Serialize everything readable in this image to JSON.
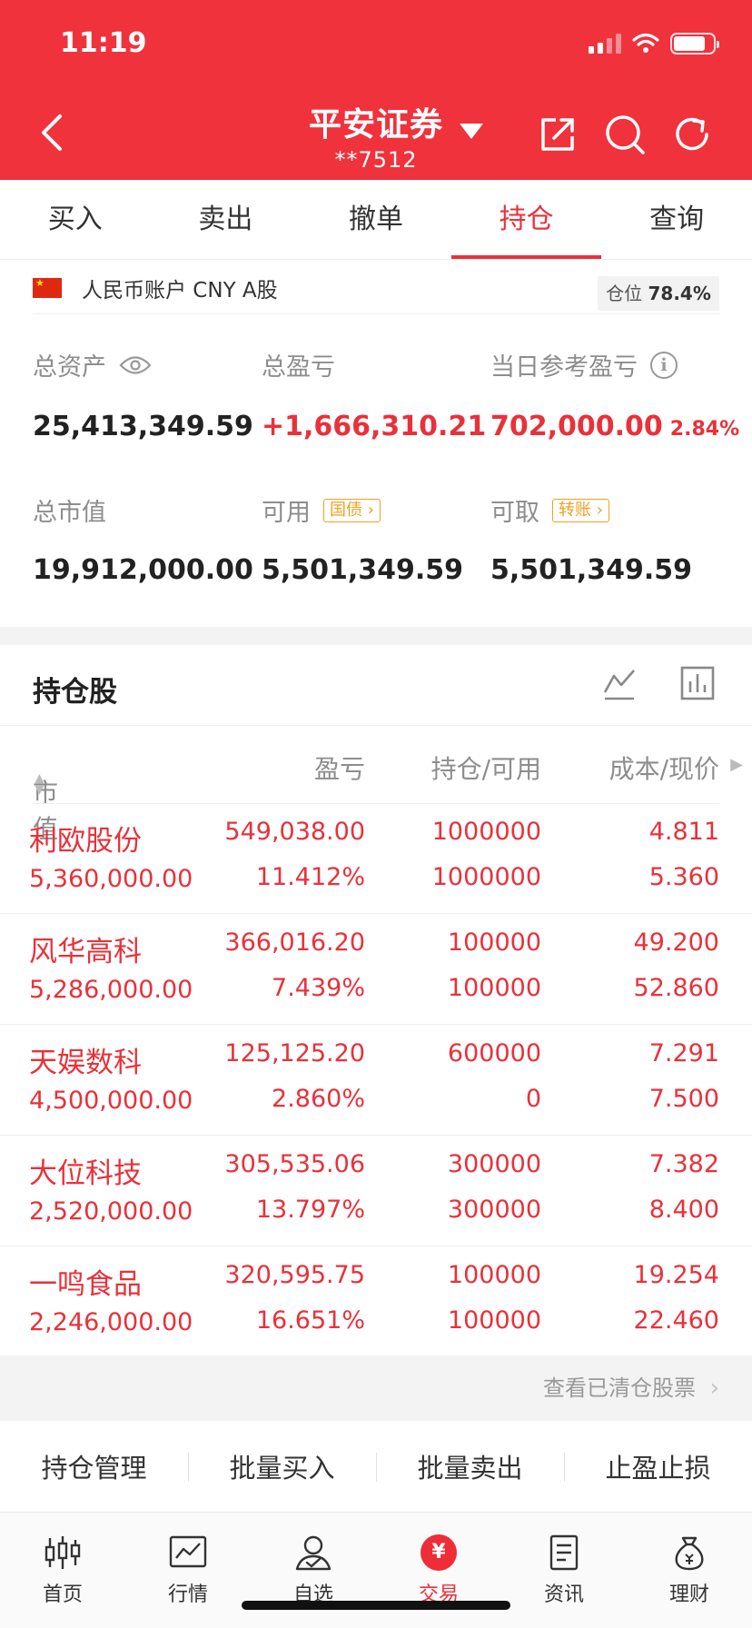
{
  "status": {
    "time": "11:19"
  },
  "header": {
    "title": "平安证券",
    "account_masked": "**7512"
  },
  "tabs": [
    {
      "label": "买入"
    },
    {
      "label": "卖出"
    },
    {
      "label": "撤单"
    },
    {
      "label": "持仓",
      "active": true
    },
    {
      "label": "查询"
    }
  ],
  "account": {
    "label": "人民币账户 CNY A股",
    "position_label": "仓位",
    "position_value": "78.4%",
    "total_assets_label": "总资产",
    "total_assets": "25,413,349.59",
    "total_pl_label": "总盈亏",
    "total_pl": "+1,666,310.21",
    "daily_pl_label": "当日参考盈亏",
    "daily_pl": "702,000.00",
    "daily_pl_pct": "2.84%",
    "market_value_label": "总市值",
    "market_value": "19,912,000.00",
    "available_label": "可用",
    "available_tag": "国债",
    "available": "5,501,349.59",
    "withdrawable_label": "可取",
    "withdrawable_tag": "转账",
    "withdrawable": "5,501,349.59"
  },
  "holdings": {
    "title": "持仓股",
    "columns": {
      "market_value": "市值",
      "pl": "盈亏",
      "position": "持仓/可用",
      "cost_price": "成本/现价"
    },
    "rows": [
      {
        "name": "利欧股份",
        "market_value": "5,360,000.00",
        "pl": "549,038.00",
        "pl_pct": "11.412%",
        "position": "1000000",
        "available": "1000000",
        "cost": "4.811",
        "price": "5.360"
      },
      {
        "name": "风华高科",
        "market_value": "5,286,000.00",
        "pl": "366,016.20",
        "pl_pct": "7.439%",
        "position": "100000",
        "available": "100000",
        "cost": "49.200",
        "price": "52.860"
      },
      {
        "name": "天娱数科",
        "market_value": "4,500,000.00",
        "pl": "125,125.20",
        "pl_pct": "2.860%",
        "position": "600000",
        "available": "0",
        "cost": "7.291",
        "price": "7.500"
      },
      {
        "name": "大位科技",
        "market_value": "2,520,000.00",
        "pl": "305,535.06",
        "pl_pct": "13.797%",
        "position": "300000",
        "available": "300000",
        "cost": "7.382",
        "price": "8.400"
      },
      {
        "name": "一鸣食品",
        "market_value": "2,246,000.00",
        "pl": "320,595.75",
        "pl_pct": "16.651%",
        "position": "100000",
        "available": "100000",
        "cost": "19.254",
        "price": "22.460"
      }
    ],
    "cleared_link": "查看已清仓股票"
  },
  "actions": [
    {
      "label": "持仓管理"
    },
    {
      "label": "批量买入"
    },
    {
      "label": "批量卖出"
    },
    {
      "label": "止盈止损"
    }
  ],
  "nav": [
    {
      "label": "首页",
      "icon": "candlestick-icon"
    },
    {
      "label": "行情",
      "icon": "chart-icon"
    },
    {
      "label": "自选",
      "icon": "user-check-icon"
    },
    {
      "label": "交易",
      "icon": "yuan-icon",
      "glyph": "¥",
      "active": true
    },
    {
      "label": "资讯",
      "icon": "document-icon"
    },
    {
      "label": "理财",
      "icon": "money-bag-icon"
    }
  ],
  "colors": {
    "brand_red": "#ef323c",
    "gain_red": "#e8313a",
    "tag_orange": "#f0a020"
  }
}
